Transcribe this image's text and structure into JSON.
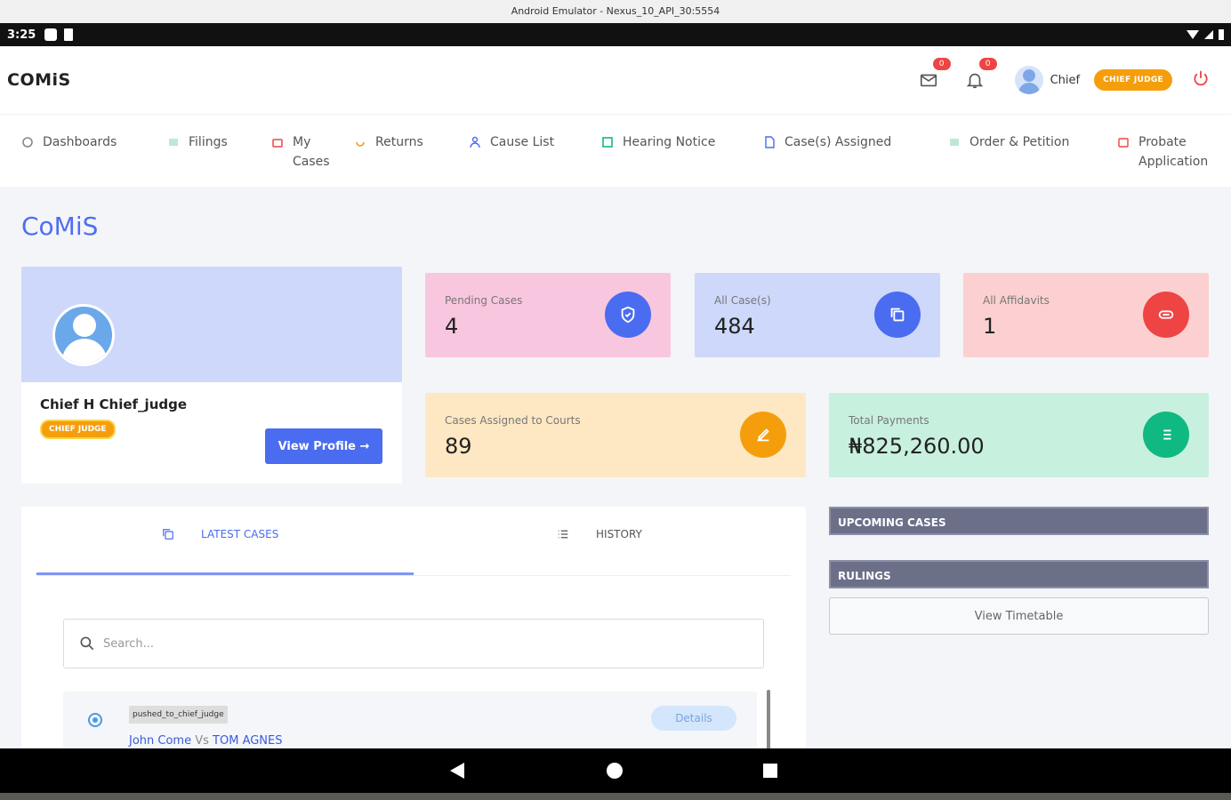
{
  "emulator": {
    "title": "Android Emulator - Nexus_10_API_30:5554"
  },
  "statusbar": {
    "time": "3:25"
  },
  "header": {
    "brand": "COMiS",
    "mail_badge": "0",
    "bell_badge": "0",
    "user_name": "Chief",
    "role_pill": "CHIEF JUDGE"
  },
  "nav": {
    "items": [
      {
        "label": "Dashboards",
        "icon": "dashboard-icon"
      },
      {
        "label": "Filings",
        "icon": "filings-icon"
      },
      {
        "label": "My Cases",
        "icon": "briefcase-icon"
      },
      {
        "label": "Returns",
        "icon": "returns-icon"
      },
      {
        "label": "Cause List",
        "icon": "user-icon"
      },
      {
        "label": "Hearing Notice",
        "icon": "notice-icon"
      },
      {
        "label": "Case(s) Assigned",
        "icon": "document-icon"
      },
      {
        "label": "Order & Petition",
        "icon": "list-icon"
      },
      {
        "label": "Probate Application",
        "icon": "probate-icon"
      }
    ]
  },
  "page": {
    "title": "CoMiS"
  },
  "profile": {
    "name": "Chief H Chief_judge",
    "role": "CHIEF JUDGE",
    "button": "View Profile →"
  },
  "stats": {
    "pending": {
      "label": "Pending Cases",
      "value": "4",
      "color": "#f9c6df",
      "icon_color": "#4a6cf0"
    },
    "all_cases": {
      "label": "All Case(s)",
      "value": "484",
      "color": "#cdd8fb",
      "icon_color": "#4a6cf0"
    },
    "affidavits": {
      "label": "All Affidavits",
      "value": "1",
      "color": "#fcd0d0",
      "icon_color": "#ef4444"
    },
    "assigned": {
      "label": "Cases Assigned to Courts",
      "value": "89",
      "color": "#fde8c3",
      "icon_color": "#f59e0b"
    },
    "payments": {
      "label": "Total Payments",
      "value": "₦825,260.00",
      "color": "#c8f0df",
      "icon_color": "#10b981"
    }
  },
  "tabs": {
    "latest": "LATEST CASES",
    "history": "HISTORY"
  },
  "search": {
    "placeholder": "Search..."
  },
  "case": {
    "status": "pushed_to_chief_judge",
    "party_a": "John Come",
    "vs": "Vs",
    "party_b": "TOM AGNES",
    "details": "Details"
  },
  "side": {
    "upcoming": "UPCOMING CASES",
    "rulings": "RULINGS",
    "timetable": "View Timetable"
  }
}
